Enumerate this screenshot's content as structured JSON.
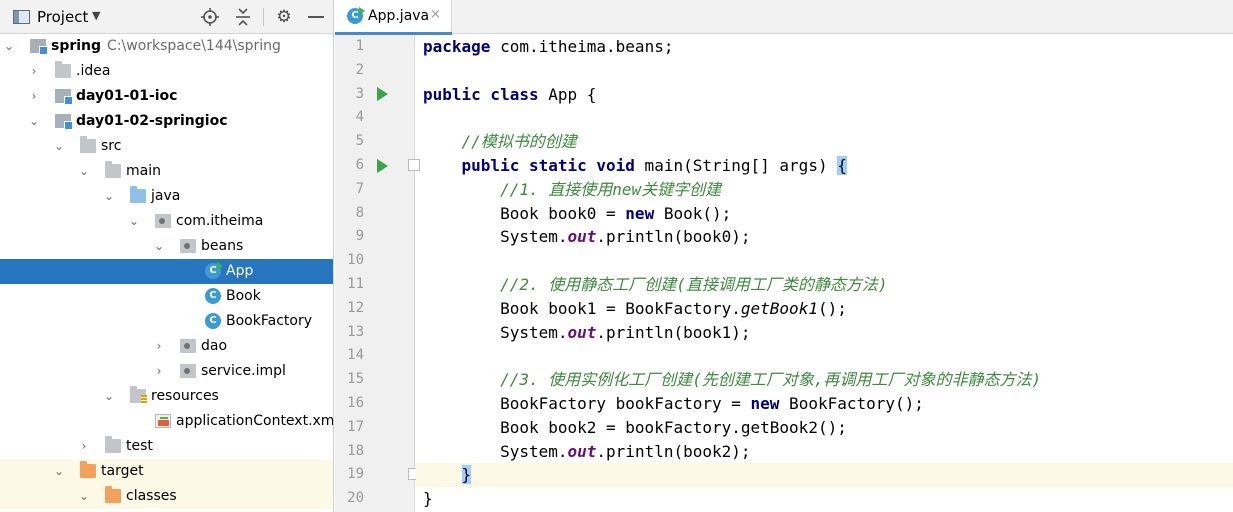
{
  "project_panel": {
    "title": "Project",
    "icons": [
      "project-panel-icon",
      "dropdown-chevron-icon",
      "locate-target-icon",
      "collapse-all-icon",
      "gear-icon",
      "hide-minimize-icon"
    ],
    "tree": [
      {
        "label": "spring",
        "path": "C:\\workspace\\144\\spring",
        "bold": true,
        "icon": "module-folder-icon",
        "expanded": true
      },
      {
        "label": ".idea",
        "icon": "folder-icon",
        "expanded": false
      },
      {
        "label": "day01-01-ioc",
        "bold": true,
        "icon": "module-folder-icon",
        "expanded": false
      },
      {
        "label": "day01-02-springioc",
        "bold": true,
        "icon": "module-folder-icon",
        "expanded": true
      },
      {
        "label": "src",
        "icon": "folder-icon",
        "expanded": true
      },
      {
        "label": "main",
        "icon": "folder-icon",
        "expanded": true
      },
      {
        "label": "java",
        "icon": "source-folder-icon",
        "expanded": true
      },
      {
        "label": "com.itheima",
        "icon": "package-icon",
        "expanded": true
      },
      {
        "label": "beans",
        "icon": "package-icon",
        "expanded": true
      },
      {
        "label": "App",
        "icon": "runnable-class-icon",
        "selected": true
      },
      {
        "label": "Book",
        "icon": "class-icon"
      },
      {
        "label": "BookFactory",
        "icon": "class-icon"
      },
      {
        "label": "dao",
        "icon": "package-icon",
        "expanded": false
      },
      {
        "label": "service.impl",
        "icon": "package-icon",
        "expanded": false
      },
      {
        "label": "resources",
        "icon": "resources-folder-icon",
        "expanded": true
      },
      {
        "label": "applicationContext.xml",
        "icon": "xml-file-icon"
      },
      {
        "label": "test",
        "icon": "folder-icon",
        "expanded": false
      },
      {
        "label": "target",
        "icon": "excluded-folder-icon",
        "expanded": true
      },
      {
        "label": "classes",
        "icon": "excluded-folder-icon",
        "expanded": true
      }
    ]
  },
  "editor": {
    "tab": {
      "label": "App.java",
      "close": "×"
    },
    "lines": [
      {
        "n": "1"
      },
      {
        "n": "2"
      },
      {
        "n": "3"
      },
      {
        "n": "4"
      },
      {
        "n": "5"
      },
      {
        "n": "6"
      },
      {
        "n": "7"
      },
      {
        "n": "8"
      },
      {
        "n": "9"
      },
      {
        "n": "10"
      },
      {
        "n": "11"
      },
      {
        "n": "12"
      },
      {
        "n": "13"
      },
      {
        "n": "14"
      },
      {
        "n": "15"
      },
      {
        "n": "16"
      },
      {
        "n": "17"
      },
      {
        "n": "18"
      },
      {
        "n": "19"
      },
      {
        "n": "20"
      }
    ],
    "code": {
      "l1": [
        [
          "package",
          "kw"
        ],
        [
          " com.itheima.beans;",
          ""
        ]
      ],
      "l2": [],
      "l3": [
        [
          "public class",
          "kw"
        ],
        [
          " App {",
          ""
        ]
      ],
      "l4": [],
      "l5": [
        [
          "    ",
          ""
        ],
        [
          "//模拟书的创建",
          "cm"
        ]
      ],
      "l6": [
        [
          "    ",
          ""
        ],
        [
          "public static void",
          "kw"
        ],
        [
          " main(String[] args) ",
          ""
        ],
        [
          "{",
          "br"
        ]
      ],
      "l7": [
        [
          "        ",
          ""
        ],
        [
          "//1. 直接使用new关键字创建",
          "cm"
        ]
      ],
      "l8": [
        [
          "        Book book0 = ",
          ""
        ],
        [
          "new",
          "kw"
        ],
        [
          " Book();",
          ""
        ]
      ],
      "l9": [
        [
          "        System.",
          ""
        ],
        [
          "out",
          "fld"
        ],
        [
          ".println(book0);",
          ""
        ]
      ],
      "l10": [],
      "l11": [
        [
          "        ",
          ""
        ],
        [
          "//2. 使用静态工厂创建(直接调用工厂类的静态方法)",
          "cm"
        ]
      ],
      "l12": [
        [
          "        Book book1 = BookFactory.",
          ""
        ],
        [
          "getBook1",
          "st"
        ],
        [
          "();",
          ""
        ]
      ],
      "l13": [
        [
          "        System.",
          ""
        ],
        [
          "out",
          "fld"
        ],
        [
          ".println(book1);",
          ""
        ]
      ],
      "l14": [],
      "l15": [
        [
          "        ",
          ""
        ],
        [
          "//3. 使用实例化工厂创建(先创建工厂对象,再调用工厂对象的非静态方法)",
          "cm"
        ]
      ],
      "l16": [
        [
          "        BookFactory bookFactory = ",
          ""
        ],
        [
          "new",
          "kw"
        ],
        [
          " BookFactory();",
          ""
        ]
      ],
      "l17": [
        [
          "        Book book2 = bookFactory.getBook2();",
          ""
        ]
      ],
      "l18": [
        [
          "        System.",
          ""
        ],
        [
          "out",
          "fld"
        ],
        [
          ".println(book2);",
          ""
        ]
      ],
      "l19": [
        [
          "    ",
          ""
        ],
        [
          "}",
          "br"
        ]
      ],
      "l20": [
        [
          "}",
          ""
        ]
      ]
    },
    "current_line": 19,
    "run_markers_on_lines": [
      3,
      6
    ]
  },
  "colors": {
    "keyword": "#000080",
    "comment": "#3e8a3e",
    "static_field": "#660e7a",
    "selection": "#2675bf",
    "brace_match": "#9ed0ff",
    "run_marker": "#3aa548"
  }
}
